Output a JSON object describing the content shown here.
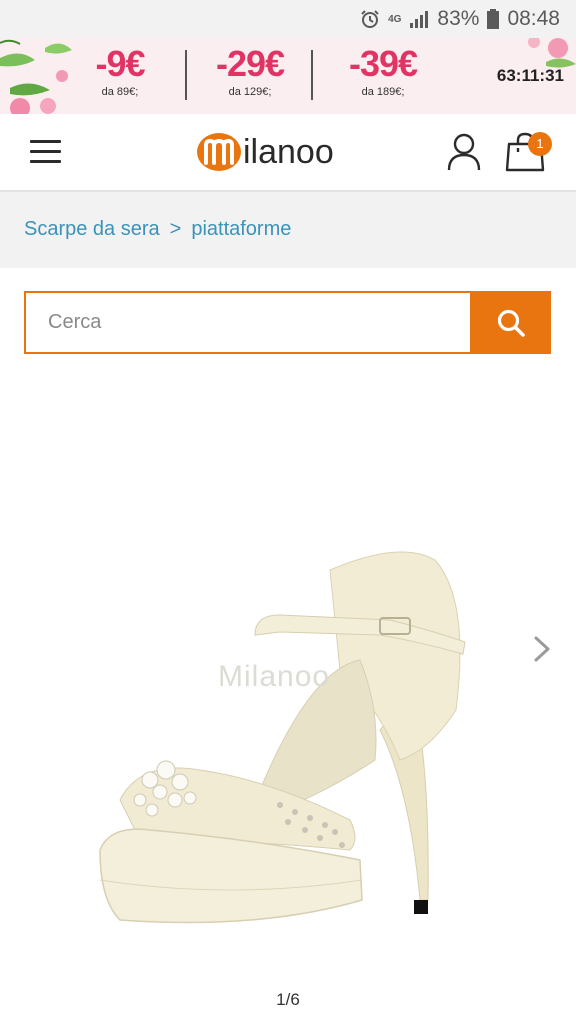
{
  "status_bar": {
    "network_label_top": "4G",
    "network_label_bottom": "",
    "battery": "83%",
    "time": "08:48"
  },
  "promo": {
    "deals": [
      {
        "amount": "-9€",
        "minimum": "da 89€;"
      },
      {
        "amount": "-29€",
        "minimum": "da 129€;"
      },
      {
        "amount": "-39€",
        "minimum": "da 189€;"
      }
    ],
    "countdown": "63:11:31",
    "accent_color": "#e03464"
  },
  "header": {
    "logo_text": "ilanoo",
    "cart_count": "1",
    "brand_color": "#e8750f"
  },
  "breadcrumb": {
    "items": [
      "Scarpe da sera",
      "piattaforme"
    ],
    "separator": ">"
  },
  "search": {
    "placeholder": "Cerca",
    "value": ""
  },
  "gallery": {
    "watermark": "Milanoo",
    "pager": "1/6"
  },
  "icons": {
    "menu": "hamburger-icon",
    "account": "user-icon",
    "cart": "shopping-bag-icon",
    "search": "search-icon",
    "next": "chevron-right-icon"
  }
}
